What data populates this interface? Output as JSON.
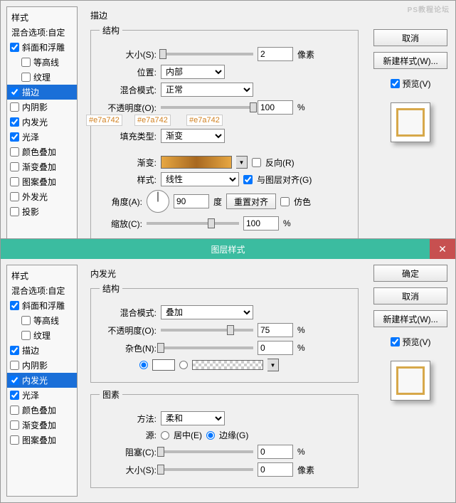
{
  "top": {
    "watermark": "PS教程论坛",
    "styles": {
      "header": "样式",
      "blend": "混合选项:自定",
      "items": [
        {
          "label": "斜面和浮雕",
          "checked": true,
          "indent": false
        },
        {
          "label": "等高线",
          "checked": false,
          "indent": true
        },
        {
          "label": "纹理",
          "checked": false,
          "indent": true
        },
        {
          "label": "描边",
          "checked": true,
          "indent": false,
          "selected": true
        },
        {
          "label": "内阴影",
          "checked": false,
          "indent": false
        },
        {
          "label": "内发光",
          "checked": true,
          "indent": false
        },
        {
          "label": "光泽",
          "checked": true,
          "indent": false
        },
        {
          "label": "颜色叠加",
          "checked": false,
          "indent": false
        },
        {
          "label": "渐变叠加",
          "checked": false,
          "indent": false
        },
        {
          "label": "图案叠加",
          "checked": false,
          "indent": false
        },
        {
          "label": "外发光",
          "checked": false,
          "indent": false
        },
        {
          "label": "投影",
          "checked": false,
          "indent": false
        }
      ]
    },
    "main": {
      "title": "描边",
      "struct_legend": "结构",
      "size_label": "大小(S):",
      "size_value": "2",
      "size_unit": "像素",
      "position_label": "位置:",
      "position_value": "内部",
      "blendmode_label": "混合模式:",
      "blendmode_value": "正常",
      "opacity_label": "不透明度(O):",
      "opacity_value": "100",
      "opacity_unit": "%",
      "filltype_label": "填充类型:",
      "filltype_value": "渐变",
      "gradient_label": "渐变:",
      "reverse_label": "反向(R)",
      "style_label": "样式:",
      "style_value": "线性",
      "align_label": "与图层对齐(G)",
      "angle_label": "角度(A):",
      "angle_value": "90",
      "angle_unit": "度",
      "reset_align": "重置对齐",
      "dither_label": "仿色",
      "scale_label": "缩放(C):",
      "scale_value": "100",
      "scale_unit": "%",
      "color_tags": [
        "#e7a742",
        "#e7a742",
        "#e7a742"
      ]
    },
    "right": {
      "cancel": "取消",
      "new_style": "新建样式(W)...",
      "preview": "预览(V)"
    }
  },
  "bottom": {
    "titlebar": "图层样式",
    "styles": {
      "header": "样式",
      "blend": "混合选项:自定",
      "items": [
        {
          "label": "斜面和浮雕",
          "checked": true,
          "indent": false
        },
        {
          "label": "等高线",
          "checked": false,
          "indent": true
        },
        {
          "label": "纹理",
          "checked": false,
          "indent": true
        },
        {
          "label": "描边",
          "checked": true,
          "indent": false
        },
        {
          "label": "内阴影",
          "checked": false,
          "indent": false
        },
        {
          "label": "内发光",
          "checked": true,
          "indent": false,
          "selected": true
        },
        {
          "label": "光泽",
          "checked": true,
          "indent": false
        },
        {
          "label": "颜色叠加",
          "checked": false,
          "indent": false
        },
        {
          "label": "渐变叠加",
          "checked": false,
          "indent": false
        },
        {
          "label": "图案叠加",
          "checked": false,
          "indent": false
        }
      ]
    },
    "main": {
      "title": "内发光",
      "struct_legend": "结构",
      "blendmode_label": "混合模式:",
      "blendmode_value": "叠加",
      "opacity_label": "不透明度(O):",
      "opacity_value": "75",
      "opacity_unit": "%",
      "noise_label": "杂色(N):",
      "noise_value": "0",
      "noise_unit": "%",
      "element_legend": "图素",
      "method_label": "方法:",
      "method_value": "柔和",
      "source_label": "源:",
      "source_center": "居中(E)",
      "source_edge": "边缘(G)",
      "choke_label": "阻塞(C):",
      "choke_value": "0",
      "choke_unit": "%",
      "size_label": "大小(S):",
      "size_value": "0",
      "size_unit": "像素"
    },
    "right": {
      "ok": "确定",
      "cancel": "取消",
      "new_style": "新建样式(W)...",
      "preview": "预览(V)"
    }
  }
}
